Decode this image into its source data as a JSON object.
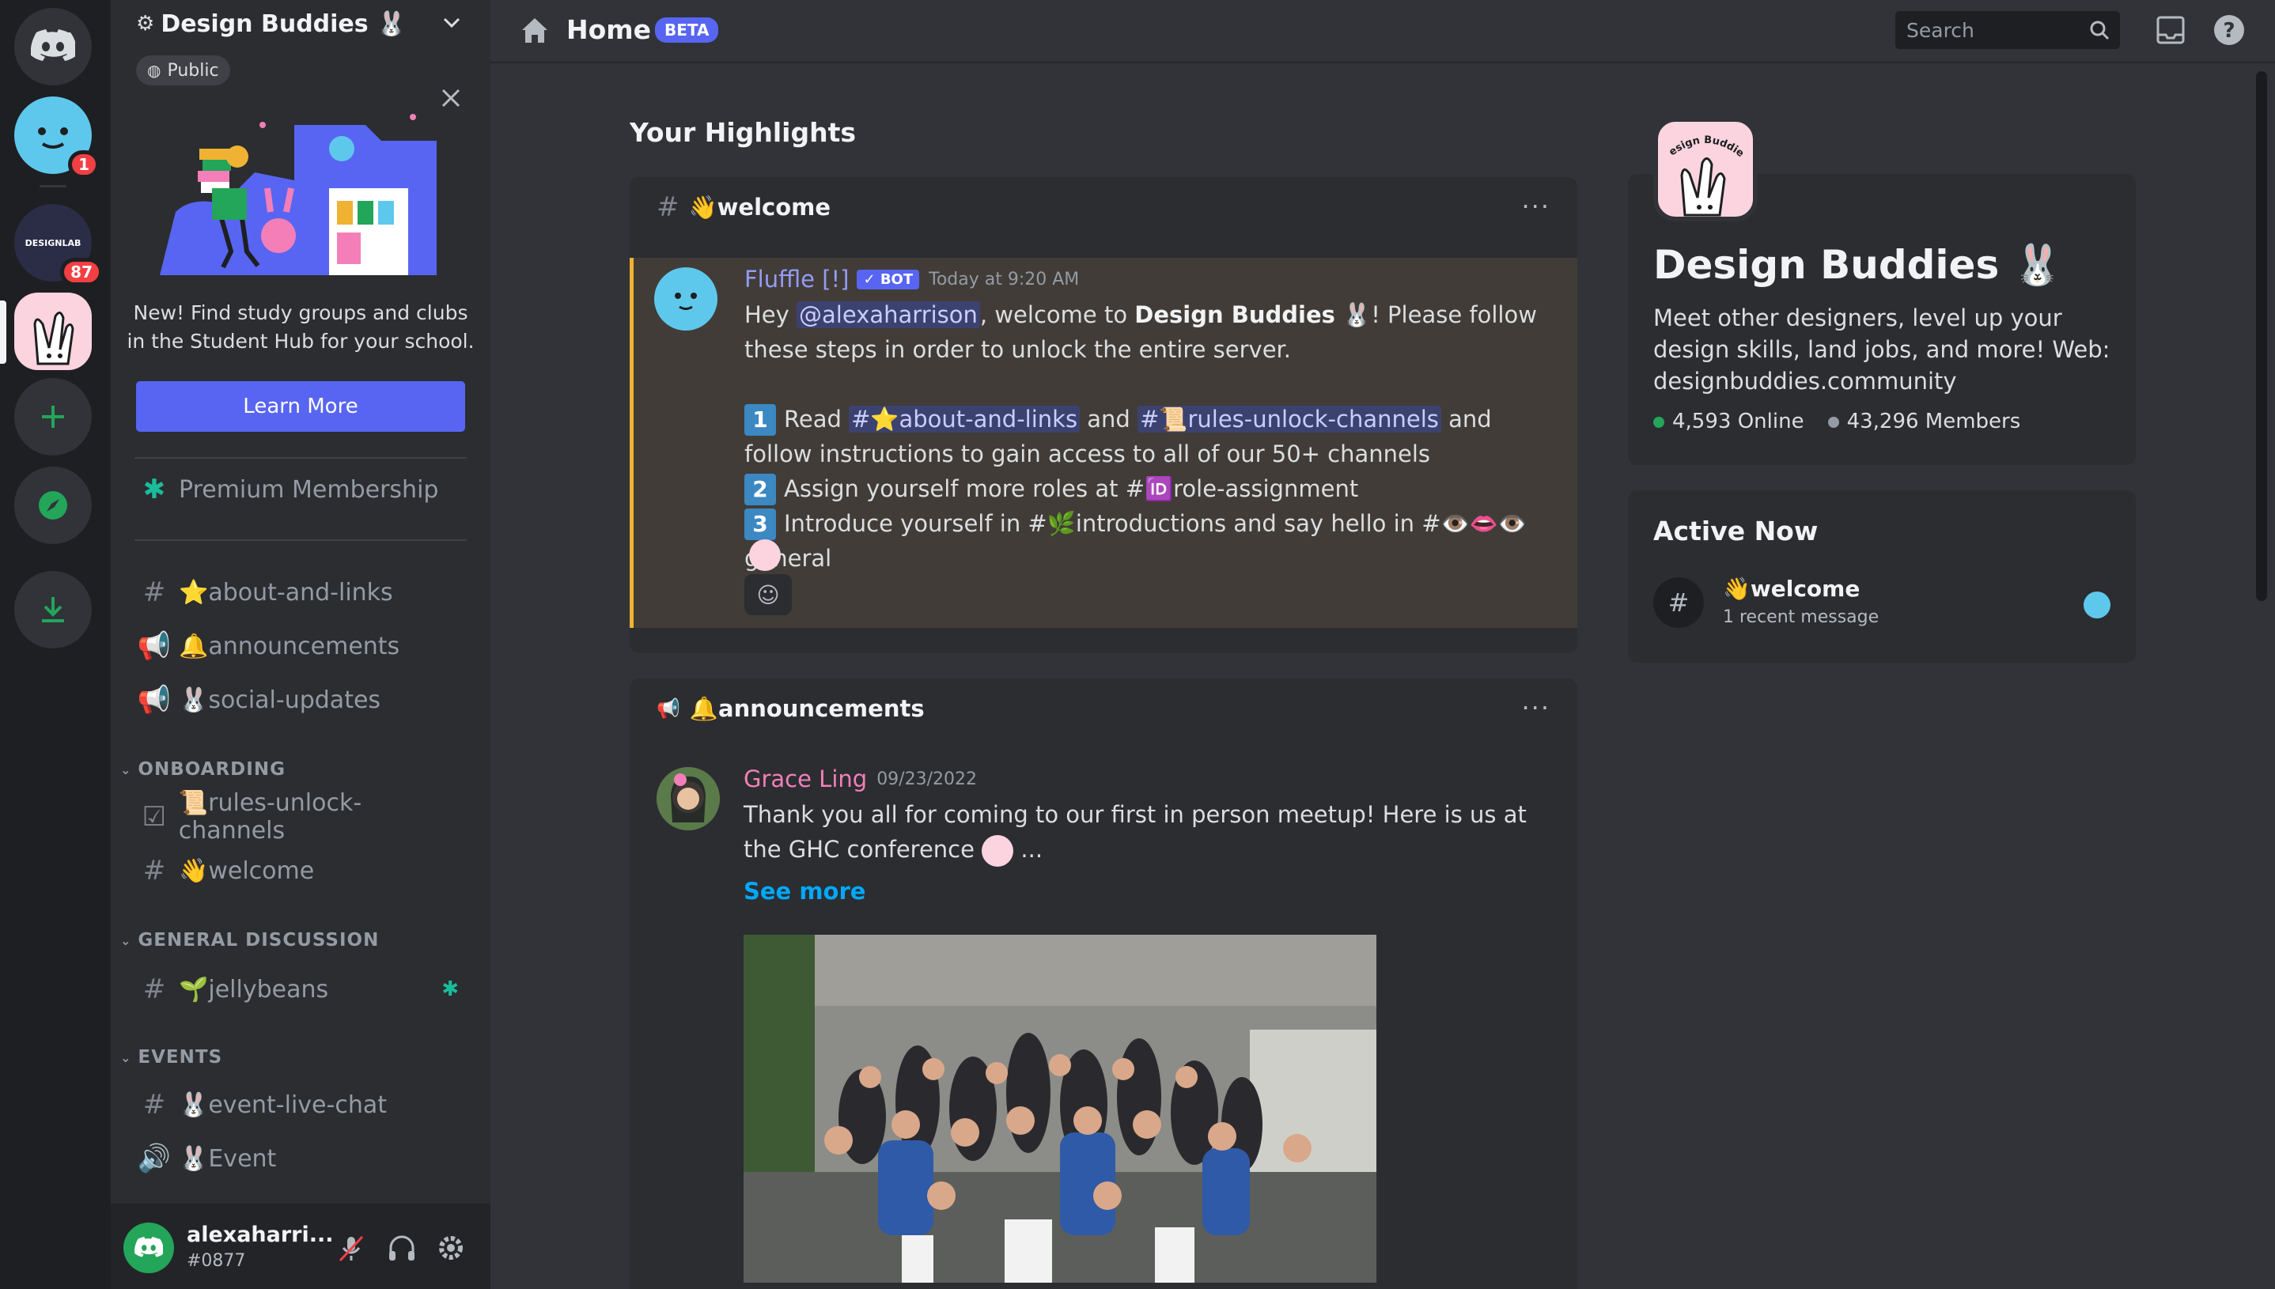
{
  "rail": {
    "dm_badge": "1",
    "designlab_label": "DESIGNLAB",
    "designlab_badge": "87",
    "icons": [
      "discord-home-icon",
      "add-server-icon",
      "explore-icon",
      "download-icon"
    ]
  },
  "server": {
    "name": "Design Buddies 🐰",
    "visibility": "Public",
    "hub_text": "New! Find study groups and clubs in the Student Hub for your school.",
    "learn_more": "Learn More",
    "premium": "Premium Membership",
    "channels_top": [
      {
        "name": "⭐about-and-links",
        "type": "text"
      },
      {
        "name": "🔔announcements",
        "type": "announce"
      },
      {
        "name": "🐰social-updates",
        "type": "announce"
      }
    ],
    "categories": [
      {
        "label": "ONBOARDING",
        "channels": [
          {
            "name": "📜rules-unlock-channels",
            "type": "rules"
          },
          {
            "name": "👋welcome",
            "type": "text"
          }
        ]
      },
      {
        "label": "GENERAL DISCUSSION",
        "channels": [
          {
            "name": "🌱jellybeans",
            "type": "text"
          }
        ]
      },
      {
        "label": "EVENTS",
        "channels": [
          {
            "name": "🐰event-live-chat",
            "type": "text"
          },
          {
            "name": "🐰Event",
            "type": "voice"
          }
        ]
      }
    ]
  },
  "user": {
    "name": "alexaharri...",
    "tag": "#0877"
  },
  "topbar": {
    "title": "Home",
    "badge": "BETA",
    "search_placeholder": "Search"
  },
  "main": {
    "highlights_title": "Your Highlights",
    "welcome_card": {
      "channel": "👋welcome",
      "author": "Fluffle [!]",
      "author_badge": "✓ BOT",
      "time": "Today at 9:20 AM",
      "line1_a": "Hey ",
      "mention": "@alexaharrison",
      "line1_b": ", welcome to ",
      "server_bold": "Design Buddies",
      "line1_c": " 🐰! Please follow these steps in order to unlock the entire server.",
      "step1_a": "Read ",
      "step1_link1": "#⭐about-and-links",
      "step1_b": " and ",
      "step1_link2": "#📜rules-unlock-channels",
      "step1_c": " and follow instructions to gain access to all of our 50+ channels",
      "step2": "Assign yourself more roles at #🆔role-assignment",
      "step3": "Introduce yourself in #🌿introductions and say hello in #👁️👄👁️general"
    },
    "announce_card": {
      "channel": "🔔announcements",
      "author": "Grace Ling",
      "time": "09/23/2022",
      "text": "Thank you all for coming to our first in person meetup! Here is us at the GHC conference",
      "ellipsis": " ...",
      "see_more": "See more"
    }
  },
  "about": {
    "name": "Design Buddies 🐰",
    "description": "Meet other designers, level up your design skills, land jobs, and more! Web: designbuddies.community",
    "online": "4,593 Online",
    "members": "43,296 Members",
    "icon_text": "Design Buddies"
  },
  "active_now": {
    "title": "Active Now",
    "channel": "👋welcome",
    "sub": "1 recent message"
  },
  "colors": {
    "accent": "#5865f2",
    "online": "#23a55a",
    "bot_name": "#949cf7",
    "grace": "#f47fb8",
    "link": "#00a8fc"
  }
}
